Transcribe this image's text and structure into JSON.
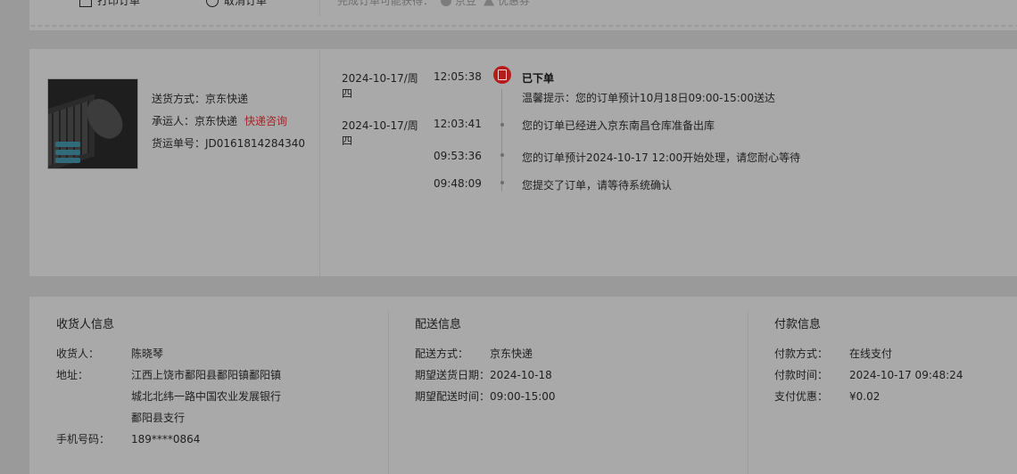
{
  "toolbar": {
    "print_label": "打印订单",
    "cancel_label": "取消订单",
    "note": "完成订单可能获得：",
    "bean_label": "京豆",
    "coupon_label": "优惠券"
  },
  "shipment": {
    "delivery_method": "送货方式：京东快递",
    "carrier_label": "承运人：京东快递",
    "carrier_link": "快递咨询",
    "tracking": "货运单号：JD0161814284340"
  },
  "tracking_events": [
    {
      "date": "2024-10-17/周四",
      "time": "12:05:38",
      "title": "已下单",
      "text": "温馨提示：您的订单预计10月18日09:00-15:00送达"
    },
    {
      "date": "2024-10-17/周四",
      "time": "12:03:41",
      "text": "您的订单已经进入京东南昌仓库准备出库"
    },
    {
      "date": "",
      "time": "09:53:36",
      "text": "您的订单预计2024-10-17 12:00开始处理，请您耐心等待"
    },
    {
      "date": "",
      "time": "09:48:09",
      "text": "您提交了订单，请等待系统确认"
    }
  ],
  "receiver": {
    "title": "收货人信息",
    "name_k": "收货人：",
    "name_v": "陈晓琴",
    "addr_k": "地址：",
    "addr_v1": "江西上饶市鄱阳县鄱阳镇鄱阳镇",
    "addr_v2": "城北北纬一路中国农业发展银行",
    "addr_v3": "鄱阳县支行",
    "phone_k": "手机号码：",
    "phone_v": "189****0864"
  },
  "delivery": {
    "title": "配送信息",
    "method_k": "配送方式：",
    "method_v": "京东快递",
    "date_k": "期望送货日期：",
    "date_v": "2024-10-18",
    "time_k": "期望配送时间：",
    "time_v": "09:00-15:00"
  },
  "payment": {
    "title": "付款信息",
    "method_k": "付款方式：",
    "method_v": "在线支付",
    "time_k": "付款时间：",
    "time_v": "2024-10-17 09:48:24",
    "discount_k": "支付优惠：",
    "discount_v": "¥0.02"
  }
}
